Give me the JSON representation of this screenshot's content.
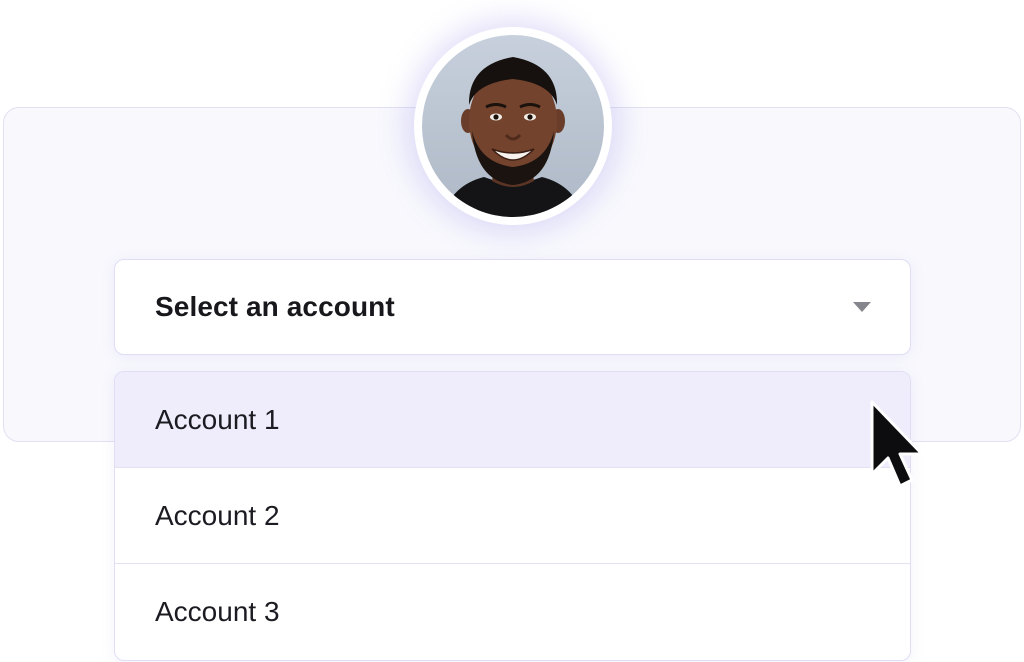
{
  "select": {
    "label": "Select an account",
    "icon": "caret-down-icon"
  },
  "options": [
    {
      "label": "Account 1",
      "highlighted": true
    },
    {
      "label": "Account 2",
      "highlighted": false
    },
    {
      "label": "Account 3",
      "highlighted": false
    }
  ],
  "avatar": {
    "icon": "user-photo"
  },
  "cursor": {
    "icon": "mouse-pointer-icon"
  },
  "colors": {
    "card_bg": "#f8f8fd",
    "border": "#e0ddf4",
    "highlight": "#efedfc",
    "text": "#17171c",
    "caret": "#85858d",
    "glow": "#968ce6"
  }
}
